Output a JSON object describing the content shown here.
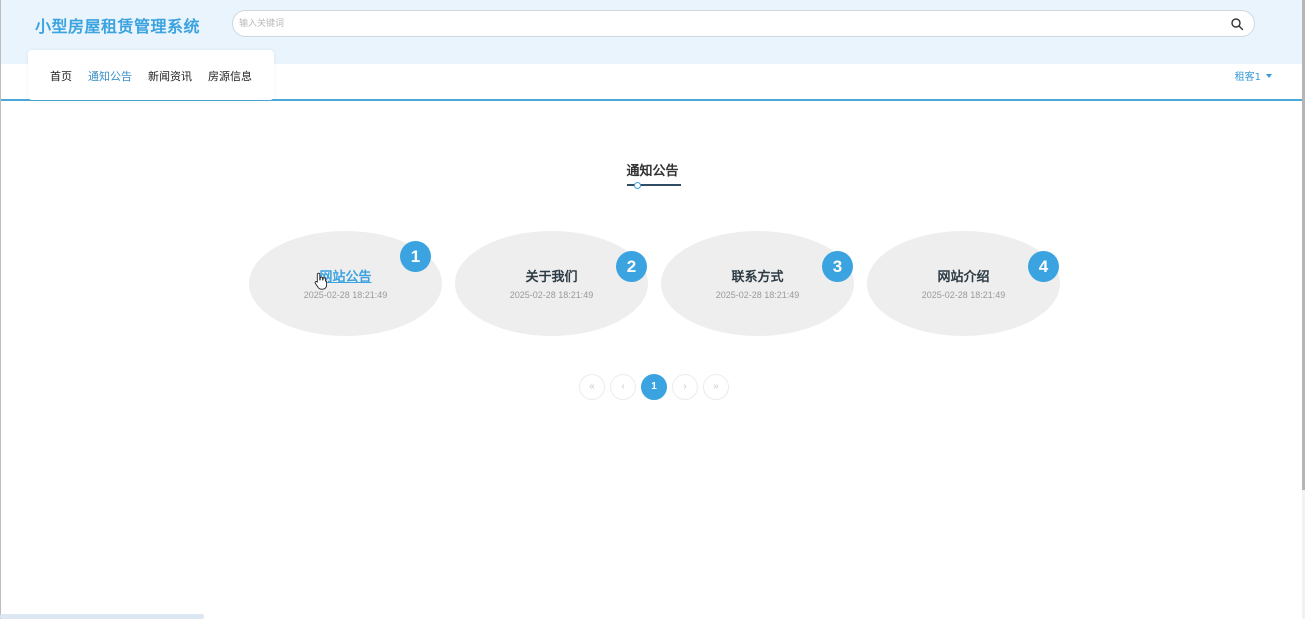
{
  "header": {
    "site_title": "小型房屋租赁管理系统",
    "search_placeholder": "输入关键词"
  },
  "nav": {
    "items": [
      {
        "label": "首页",
        "active": false
      },
      {
        "label": "通知公告",
        "active": true
      },
      {
        "label": "新闻资讯",
        "active": false
      },
      {
        "label": "房源信息",
        "active": false
      }
    ]
  },
  "user_menu": {
    "label": "租客1"
  },
  "section": {
    "title": "通知公告"
  },
  "cards": [
    {
      "title": "网站公告",
      "date": "2025-02-28 18:21:49",
      "badge": "1"
    },
    {
      "title": "关于我们",
      "date": "2025-02-28 18:21:49",
      "badge": "2"
    },
    {
      "title": "联系方式",
      "date": "2025-02-28 18:21:49",
      "badge": "3"
    },
    {
      "title": "网站介绍",
      "date": "2025-02-28 18:21:49",
      "badge": "4"
    }
  ],
  "pagination": {
    "first": "«",
    "prev": "‹",
    "current": "1",
    "next": "›",
    "last": "»"
  },
  "colors": {
    "accent": "#3aa3e0",
    "header_bg": "#e9f4fc",
    "card_bg": "#eeeeee"
  },
  "icons": {
    "search": "search-icon",
    "cursor": "hand-pointer-icon",
    "caret": "caret-down-icon"
  }
}
